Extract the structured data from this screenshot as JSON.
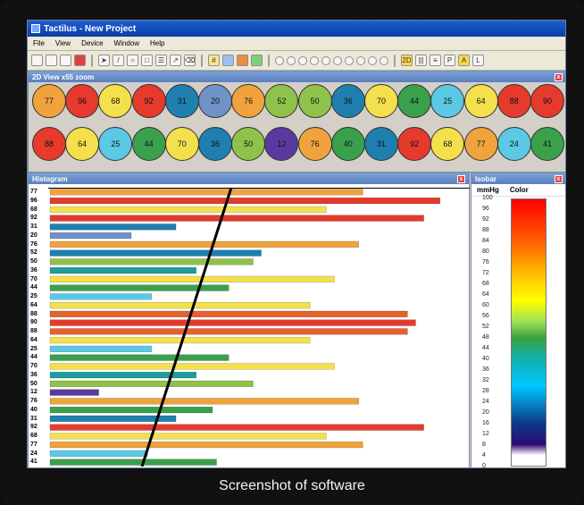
{
  "window": {
    "title": "Tactilus - New Project"
  },
  "menubar": {
    "items": [
      "File",
      "View",
      "Device",
      "Window",
      "Help"
    ]
  },
  "view2d": {
    "title": "2D View",
    "zoom": "x55 zoom",
    "row1": [
      77,
      96,
      68,
      92,
      31,
      20,
      76,
      52,
      50,
      36,
      70,
      44,
      25,
      64,
      88,
      90
    ],
    "row2": [
      88,
      64,
      25,
      44,
      70,
      36,
      50,
      12,
      76,
      40,
      31,
      92,
      68,
      77,
      24,
      41
    ]
  },
  "histogram": {
    "title": "Histogram",
    "rows": [
      {
        "label": "77",
        "value": 77,
        "color": "#f0a33c"
      },
      {
        "label": "96",
        "value": 96,
        "color": "#e53a2c"
      },
      {
        "label": "68",
        "value": 68,
        "color": "#f4e04d"
      },
      {
        "label": "92",
        "value": 92,
        "color": "#e53a2c"
      },
      {
        "label": "31",
        "value": 31,
        "color": "#1f7fae"
      },
      {
        "label": "20",
        "value": 20,
        "color": "#6f93c9"
      },
      {
        "label": "76",
        "value": 76,
        "color": "#f0a33c"
      },
      {
        "label": "52",
        "value": 52,
        "color": "#1f7fae"
      },
      {
        "label": "50",
        "value": 50,
        "color": "#8fc24a"
      },
      {
        "label": "36",
        "value": 36,
        "color": "#1f9b9b"
      },
      {
        "label": "70",
        "value": 70,
        "color": "#f4e04d"
      },
      {
        "label": "44",
        "value": 44,
        "color": "#3aa04c"
      },
      {
        "label": "25",
        "value": 25,
        "color": "#5bc9e6"
      },
      {
        "label": "64",
        "value": 64,
        "color": "#f4e04d"
      },
      {
        "label": "88",
        "value": 88,
        "color": "#e5622c"
      },
      {
        "label": "90",
        "value": 90,
        "color": "#e53a2c"
      },
      {
        "label": "88",
        "value": 88,
        "color": "#e5622c"
      },
      {
        "label": "64",
        "value": 64,
        "color": "#f4e04d"
      },
      {
        "label": "25",
        "value": 25,
        "color": "#5bc9e6"
      },
      {
        "label": "44",
        "value": 44,
        "color": "#3aa04c"
      },
      {
        "label": "70",
        "value": 70,
        "color": "#f4e04d"
      },
      {
        "label": "36",
        "value": 36,
        "color": "#1f9b9b"
      },
      {
        "label": "50",
        "value": 50,
        "color": "#8fc24a"
      },
      {
        "label": "12",
        "value": 12,
        "color": "#5b3aa0"
      },
      {
        "label": "76",
        "value": 76,
        "color": "#f0a33c"
      },
      {
        "label": "40",
        "value": 40,
        "color": "#3aa04c"
      },
      {
        "label": "31",
        "value": 31,
        "color": "#1f7fae"
      },
      {
        "label": "92",
        "value": 92,
        "color": "#e53a2c"
      },
      {
        "label": "68",
        "value": 68,
        "color": "#f4e04d"
      },
      {
        "label": "77",
        "value": 77,
        "color": "#f0a33c"
      },
      {
        "label": "24",
        "value": 24,
        "color": "#5bc9e6"
      },
      {
        "label": "41",
        "value": 41,
        "color": "#3aa04c"
      }
    ],
    "xmax": 100
  },
  "isobar": {
    "title": "Isobar",
    "units_label": "mmHg",
    "color_label": "Color",
    "scale": [
      100,
      96,
      92,
      88,
      84,
      80,
      76,
      72,
      68,
      64,
      60,
      56,
      52,
      48,
      44,
      40,
      36,
      32,
      28,
      24,
      20,
      16,
      12,
      8,
      4,
      0
    ]
  },
  "colors": {
    "red": "#e53a2c",
    "orange": "#f0a33c",
    "yellow": "#f4e04d",
    "green": "#3aa04c",
    "teal": "#1f9b9b",
    "blue": "#1f7fae",
    "lightblue": "#5bc9e6",
    "purple": "#5b3aa0"
  },
  "caption": "Screenshot of software"
}
